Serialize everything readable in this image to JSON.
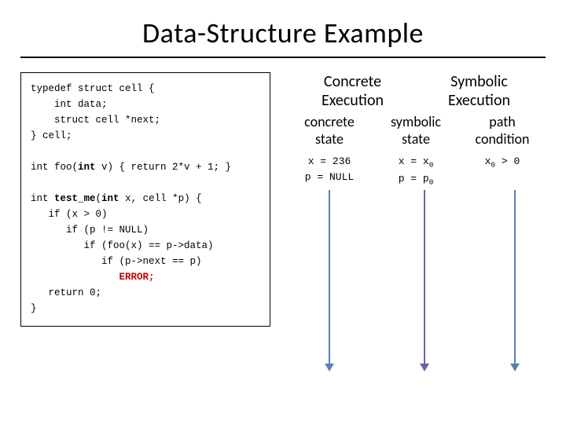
{
  "title": "Data-Structure Example",
  "code": {
    "l1": "typedef struct cell {",
    "l2": "    int data;",
    "l3": "    struct cell *next;",
    "l4": "} cell;",
    "l5": "",
    "l6a": "int foo(",
    "l6b": "int",
    "l6c": " v) { return 2*v + 1; }",
    "l7": "",
    "l8a": "int ",
    "l8b": "test_me",
    "l8c": "(",
    "l8d": "int",
    "l8e": " x, cell *p) {",
    "l9": "   if (x > 0)",
    "l10": "      if (p != NULL)",
    "l11": "         if (foo(x) == p->data)",
    "l12": "            if (p->next == p)",
    "l13": "               ",
    "l13err": "ERROR;",
    "l14": "   return 0;",
    "l15": "}"
  },
  "headings": {
    "concrete_exec": "Concrete\nExecution",
    "symbolic_exec": "Symbolic\nExecution",
    "concrete_state": "concrete\nstate",
    "symbolic_state": "symbolic\nstate",
    "path_condition": "path\ncondition"
  },
  "columns": {
    "concrete_state_vals": "x = 236\np = NULL",
    "symbolic_state_line1a": "x = x",
    "symbolic_state_line2a": "p = p",
    "sub0": "0",
    "path_line_a": "x",
    "path_line_b": " > 0"
  },
  "chart_data": {
    "type": "table",
    "title": "Data-Structure Example",
    "columns": [
      "concrete state",
      "symbolic state",
      "path condition"
    ],
    "rows": [
      {
        "concrete state": "x = 236",
        "symbolic state": "x = x0",
        "path condition": "x0 > 0"
      },
      {
        "concrete state": "p = NULL",
        "symbolic state": "p = p0",
        "path condition": ""
      }
    ],
    "groups": {
      "Concrete Execution": [
        "concrete state"
      ],
      "Symbolic Execution": [
        "symbolic state",
        "path condition"
      ]
    }
  }
}
